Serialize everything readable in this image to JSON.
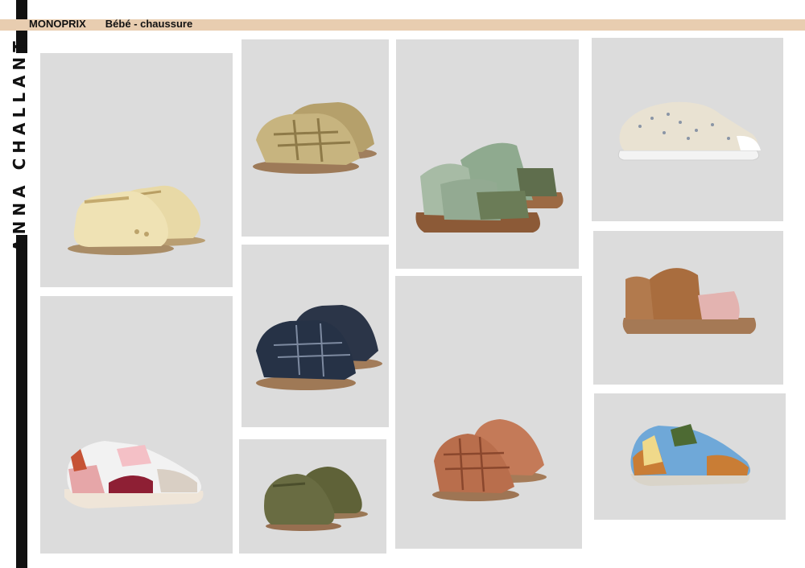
{
  "header": {
    "brand": "MONOPRIX",
    "category": "Bébé - chaussure"
  },
  "sidebar": {
    "designer_name": "ANNA CHALLANT"
  },
  "products": [
    {
      "icon": "gold-t-bar-shoe-icon",
      "color": "#d8c690"
    },
    {
      "icon": "gold-sandal-icon",
      "color": "#b9a775"
    },
    {
      "icon": "green-strap-sandal-icon",
      "color": "#8aa389"
    },
    {
      "icon": "floral-canvas-shoe-icon",
      "color": "#e9e2d2"
    },
    {
      "icon": "navy-sandal-icon",
      "color": "#263246"
    },
    {
      "icon": "white-pink-sneaker-icon",
      "color": "#e9d7cf"
    },
    {
      "icon": "khaki-t-bar-shoe-icon",
      "color": "#66693f"
    },
    {
      "icon": "tan-fisherman-sandal-icon",
      "color": "#b97050"
    },
    {
      "icon": "camel-pink-sandal-icon",
      "color": "#b27a4d"
    },
    {
      "icon": "multicolor-sneaker-icon",
      "color": "#6fa8d8"
    }
  ]
}
